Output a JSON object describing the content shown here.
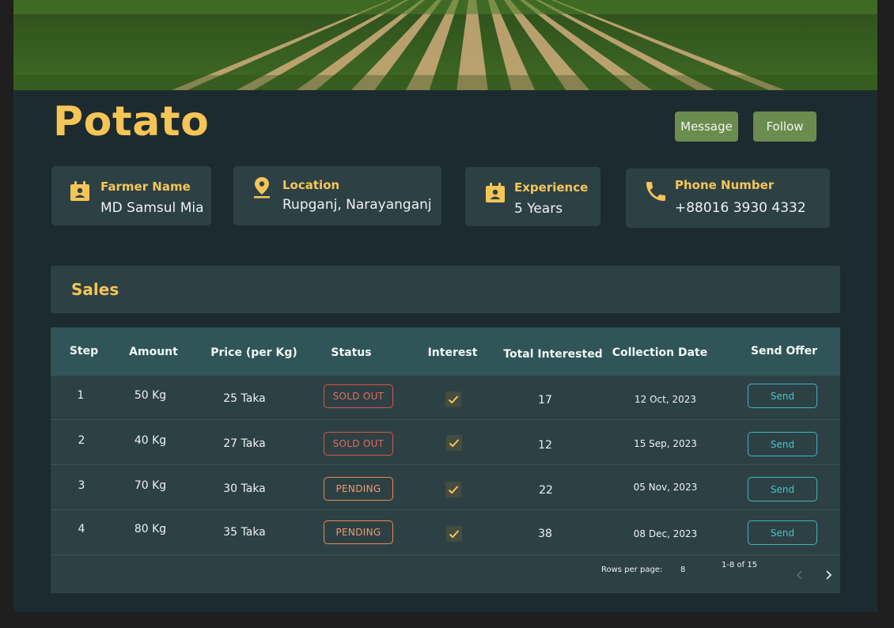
{
  "header": {
    "title": "Potato",
    "buttons": {
      "message": "Message",
      "follow": "Follow"
    }
  },
  "info_cards": {
    "farmer": {
      "label": "Farmer Name",
      "value": "MD Samsul Mia",
      "icon": "contact-calendar-icon"
    },
    "location": {
      "label": "Location",
      "value": "Rupganj, Narayanganj",
      "icon": "map-pin-icon"
    },
    "experience": {
      "label": "Experience",
      "value": "5 Years",
      "icon": "contact-calendar-icon"
    },
    "phone": {
      "label": "Phone Number",
      "value": "+88016 3930 4332",
      "icon": "phone-icon"
    }
  },
  "sales": {
    "title": "Sales",
    "columns": [
      "Step",
      "Amount",
      "Price (per Kg)",
      "Status",
      "Interest",
      "Total Interested",
      "Collection Date",
      "Send Offer"
    ],
    "rows": [
      {
        "step": "1",
        "amount": "50 Kg",
        "price": "25 Taka",
        "status": "SOLD OUT",
        "status_type": "sold",
        "interest": true,
        "total": "17",
        "date": "12 Oct, 2023",
        "action": "Send"
      },
      {
        "step": "2",
        "amount": "40 Kg",
        "price": "27 Taka",
        "status": "SOLD OUT",
        "status_type": "sold",
        "interest": true,
        "total": "12",
        "date": "15 Sep, 2023",
        "action": "Send"
      },
      {
        "step": "3",
        "amount": "70 Kg",
        "price": "30 Taka",
        "status": "PENDING",
        "status_type": "pending",
        "interest": true,
        "total": "22",
        "date": "05 Nov, 2023",
        "action": "Send"
      },
      {
        "step": "4",
        "amount": "80 Kg",
        "price": "35 Taka",
        "status": "PENDING",
        "status_type": "pending",
        "interest": true,
        "total": "38",
        "date": "08 Dec, 2023",
        "action": "Send"
      }
    ],
    "pagination": {
      "rows_per_page_label": "Rows per page:",
      "rows_per_page": "8",
      "range": "1-8 of 15"
    }
  },
  "colors": {
    "accent": "#f6c557",
    "button": "#6a8c4e",
    "send": "#3fb7b4",
    "sold": "#d9534a",
    "pending": "#e68a5b"
  }
}
